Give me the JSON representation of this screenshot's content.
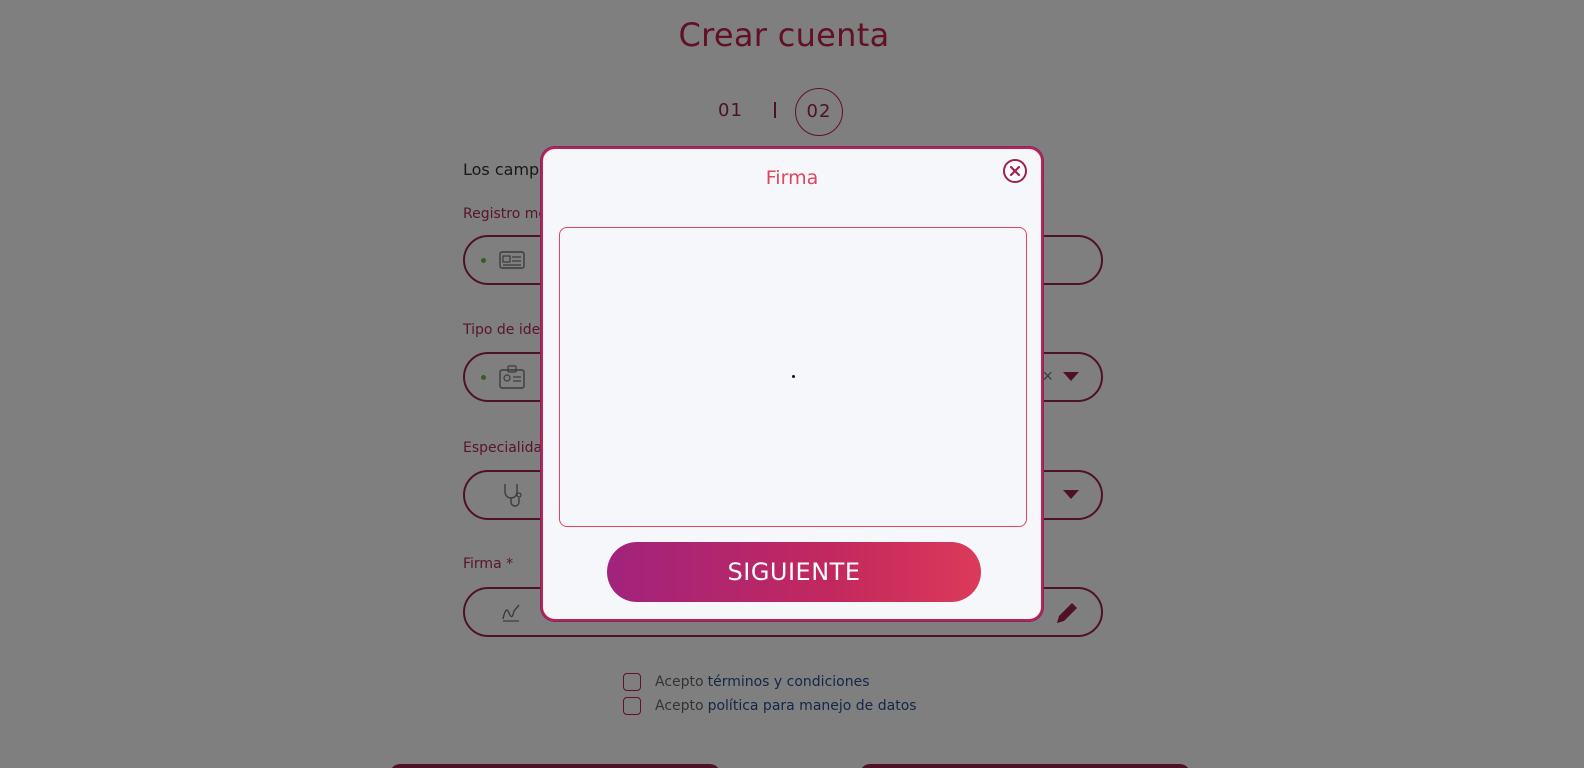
{
  "page": {
    "title": "Crear cuenta",
    "steps": [
      "01",
      "02"
    ],
    "intro_prefix": "Los campo",
    "fields": {
      "registro": {
        "label": "Registro mé"
      },
      "tipo_id": {
        "label": "Tipo de ider",
        "clear_glyph": "×"
      },
      "especialidad": {
        "label": "Especialidad"
      },
      "firma": {
        "label": "Firma *"
      }
    },
    "terms": [
      {
        "prefix": "Acepto",
        "link": "términos y condiciones"
      },
      {
        "prefix": "Acepto",
        "link": "política para manejo de datos"
      }
    ]
  },
  "modal": {
    "title": "Firma",
    "button_label": "SIGUIENTE"
  },
  "colors": {
    "accent": "#c2214a",
    "accent_dark": "#9c2350",
    "modal_title": "#e0455c",
    "link": "#2a4f8f"
  },
  "icons": [
    "id-card-icon",
    "badge-icon",
    "stethoscope-icon",
    "signature-icon",
    "pencil-icon",
    "close-circle-icon",
    "chevron-down-icon"
  ]
}
